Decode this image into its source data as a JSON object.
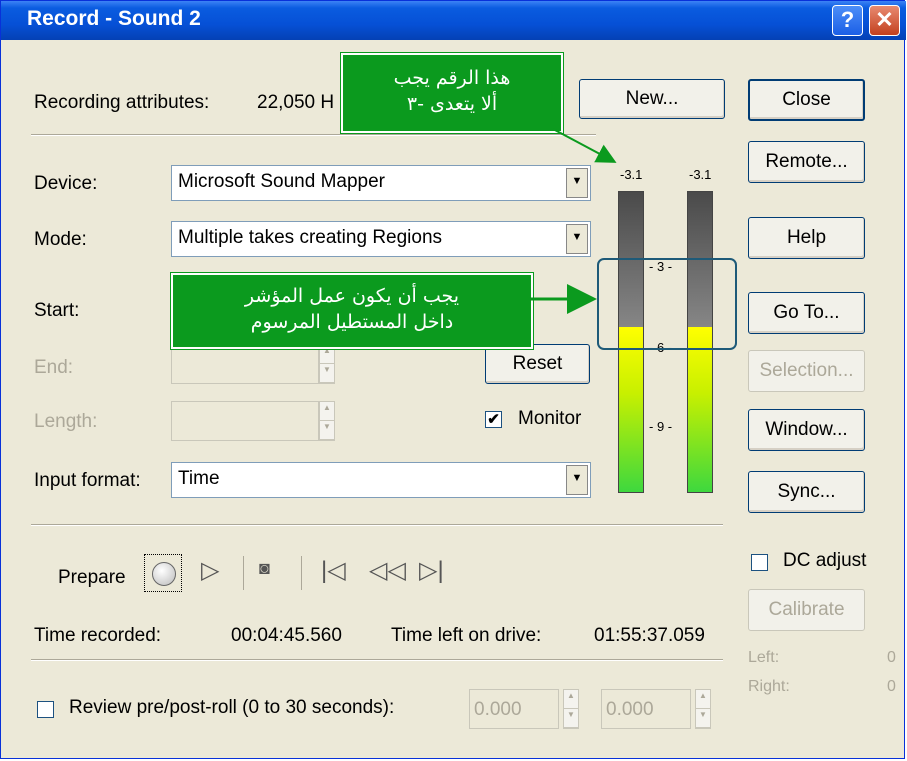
{
  "window": {
    "title": "Record - Sound 2",
    "help_button": "?",
    "close_button": "✕"
  },
  "recording_attributes": {
    "label": "Recording attributes:",
    "value": "22,050 H"
  },
  "buttons": {
    "new": "New...",
    "close": "Close",
    "remote": "Remote...",
    "help": "Help",
    "goto": "Go To...",
    "selection": "Selection...",
    "window": "Window...",
    "sync": "Sync...",
    "reset": "Reset",
    "calibrate": "Calibrate"
  },
  "device": {
    "label": "Device:",
    "value": "Microsoft Sound Mapper"
  },
  "mode": {
    "label": "Mode:",
    "value": "Multiple takes creating Regions"
  },
  "start": {
    "label": "Start:"
  },
  "end": {
    "label": "End:"
  },
  "length": {
    "label": "Length:"
  },
  "monitor": {
    "label": "Monitor",
    "checked": true
  },
  "input_format": {
    "label": "Input format:",
    "value": "Time"
  },
  "transport": {
    "prepare_label": "Prepare"
  },
  "dc_adjust": {
    "label": "DC adjust",
    "checked": false
  },
  "meters": {
    "left_peak": "-3.1",
    "right_peak": "-3.1",
    "scale": [
      "3",
      "6",
      "9"
    ],
    "left_level_fraction": 0.55,
    "right_level_fraction": 0.55
  },
  "levels": {
    "left_label": "Left:",
    "left_value": "0",
    "right_label": "Right:",
    "right_value": "0"
  },
  "time_recorded": {
    "label": "Time recorded:",
    "value": "00:04:45.560"
  },
  "time_left": {
    "label": "Time left on drive:",
    "value": "01:55:37.059"
  },
  "review": {
    "label": "Review pre/post-roll (0 to 30 seconds):",
    "checked": false,
    "pre_value": "0.000",
    "post_value": "0.000"
  },
  "annotations": {
    "callout_top_line1": "هذا الرقم يجب",
    "callout_top_line2": "ألا يتعدى -٣",
    "callout_mid_line1": "يجب أن يكون عمل المؤشر",
    "callout_mid_line2": "داخل المستطيل المرسوم"
  },
  "colors": {
    "titlebar": "#0650d6",
    "dialog": "#ece9d8",
    "callout": "#0b9a1e",
    "meter_fill_top": "#ffff00",
    "meter_fill_bottom": "#3ed83e"
  }
}
